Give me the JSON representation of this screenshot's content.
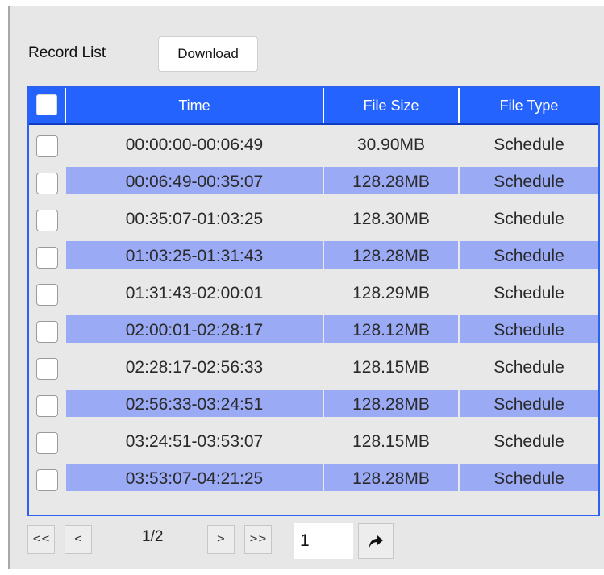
{
  "panel": {
    "title": "Record List",
    "download_label": "Download"
  },
  "table": {
    "columns": [
      "Time",
      "File Size",
      "File Type"
    ],
    "rows": [
      {
        "time": "00:00:00-00:06:49",
        "size": "30.90MB",
        "type": "Schedule",
        "checked": false
      },
      {
        "time": "00:06:49-00:35:07",
        "size": "128.28MB",
        "type": "Schedule",
        "checked": false
      },
      {
        "time": "00:35:07-01:03:25",
        "size": "128.30MB",
        "type": "Schedule",
        "checked": false
      },
      {
        "time": "01:03:25-01:31:43",
        "size": "128.28MB",
        "type": "Schedule",
        "checked": false
      },
      {
        "time": "01:31:43-02:00:01",
        "size": "128.29MB",
        "type": "Schedule",
        "checked": false
      },
      {
        "time": "02:00:01-02:28:17",
        "size": "128.12MB",
        "type": "Schedule",
        "checked": false
      },
      {
        "time": "02:28:17-02:56:33",
        "size": "128.15MB",
        "type": "Schedule",
        "checked": false
      },
      {
        "time": "02:56:33-03:24:51",
        "size": "128.28MB",
        "type": "Schedule",
        "checked": false
      },
      {
        "time": "03:24:51-03:53:07",
        "size": "128.15MB",
        "type": "Schedule",
        "checked": false
      },
      {
        "time": "03:53:07-04:21:25",
        "size": "128.28MB",
        "type": "Schedule",
        "checked": false
      }
    ]
  },
  "pager": {
    "first_label": "<<",
    "prev_label": "<",
    "page_indicator": "1/2",
    "next_label": ">",
    "last_label": ">>",
    "page_input_value": "1",
    "go_icon": "redo-arrow-icon"
  },
  "colors": {
    "header_bg": "#2563ff",
    "stripe_bg": "#9aaaf5",
    "panel_bg": "#e7e7e7"
  }
}
